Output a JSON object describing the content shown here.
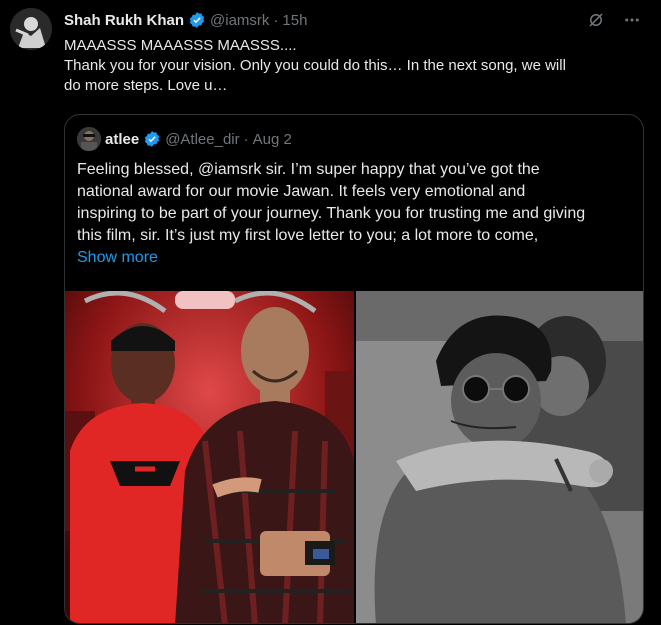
{
  "tweet": {
    "author_name": "Shah Rukh Khan",
    "author_handle": "@iamsrk",
    "separator": "·",
    "time": "15h",
    "lines": [
      "MAAASSS MAAASSS MAASSS....",
      "Thank you for your vision. Only you could do this… In the next song, we will",
      "do more steps. Love u…"
    ],
    "actions": [
      "grok-icon",
      "more-icon"
    ]
  },
  "quote": {
    "author_name": "atlee",
    "author_handle": "@Atlee_dir",
    "separator": "·",
    "date": "Aug 2",
    "lines": [
      "Feeling blessed, @iamsrk sir. I’m super happy that you’ve got the",
      "national award for our movie Jawan. It feels very emotional and",
      "inspiring to be part of your journey. Thank you for trusting me and giving",
      "this film, sir. It’s just my first love letter to you; a lot more to come,"
    ],
    "show_more": "Show more",
    "media": [
      "photo-red-train",
      "photo-black-white-hug"
    ]
  },
  "colors": {
    "background": "#000000",
    "text": "#e7e9ea",
    "muted": "#71767b",
    "link": "#1d9bf0",
    "border": "#2f3336",
    "verified": "#1d9bf0"
  }
}
